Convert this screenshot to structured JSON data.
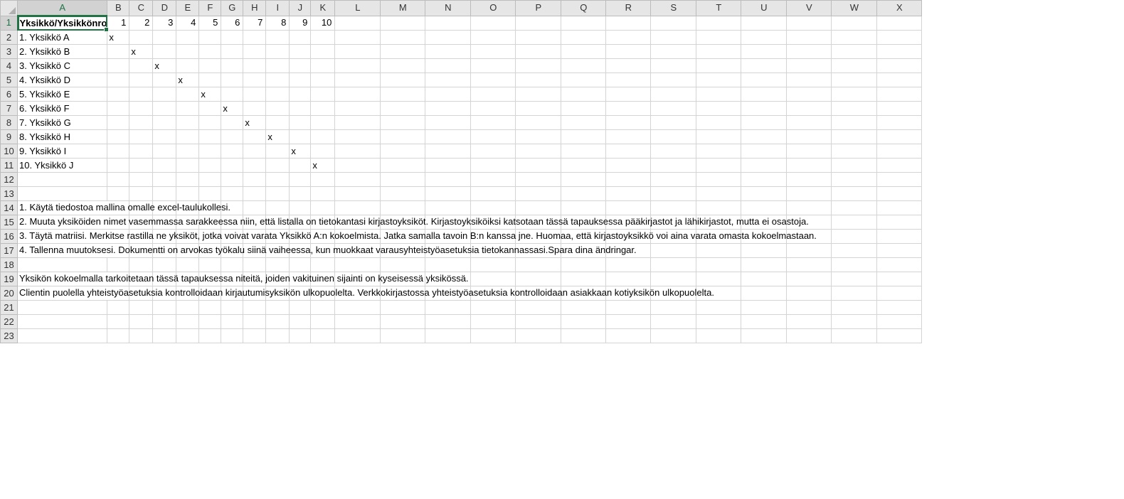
{
  "columns": [
    "A",
    "B",
    "C",
    "D",
    "E",
    "F",
    "G",
    "H",
    "I",
    "J",
    "K",
    "L",
    "M",
    "N",
    "O",
    "P",
    "Q",
    "R",
    "S",
    "T",
    "U",
    "V",
    "W",
    "X"
  ],
  "active_cell": "A1",
  "header": {
    "A1": "Yksikkö/Yksikkönro",
    "numbers": [
      "1",
      "2",
      "3",
      "4",
      "5",
      "6",
      "7",
      "8",
      "9",
      "10"
    ]
  },
  "units": [
    {
      "name": "1. Yksikkö  A",
      "mark_col": 1
    },
    {
      "name": "2. Yksikkö B",
      "mark_col": 2
    },
    {
      "name": "3. Yksikkö C",
      "mark_col": 3
    },
    {
      "name": "4. Yksikkö D",
      "mark_col": 4
    },
    {
      "name": "5. Yksikkö E",
      "mark_col": 5
    },
    {
      "name": "6. Yksikkö F",
      "mark_col": 6
    },
    {
      "name": "7. Yksikkö G",
      "mark_col": 7
    },
    {
      "name": "8. Yksikkö H",
      "mark_col": 8
    },
    {
      "name": "9. Yksikkö I",
      "mark_col": 9
    },
    {
      "name": "10. Yksikkö J",
      "mark_col": 10
    }
  ],
  "mark": "x",
  "instructions": {
    "r14": "1. Käytä tiedostoa mallina omalle excel-taulukollesi.",
    "r15": "2. Muuta yksiköiden nimet vasemmassa sarakkeessa niin, että listalla on tietokantasi kirjastoyksiköt. Kirjastoyksiköiksi katsotaan tässä tapauksessa pääkirjastot ja lähikirjastot, mutta ei osastoja.",
    "r16": "3.  Täytä matriisi. Merkitse rastilla ne yksiköt, jotka voivat varata Yksikkö A:n kokoelmista. Jatka samalla tavoin B:n kanssa jne. Huomaa, että kirjastoyksikkö voi aina varata omasta kokoelmastaan.",
    "r17": "4. Tallenna muutoksesi. Dokumentti on arvokas työkalu siinä vaiheessa, kun muokkaat varausyhteistyöasetuksia tietokannassasi.Spara dina ändringar.",
    "r19": "Yksikön kokoelmalla tarkoitetaan tässä tapauksessa niteitä, joiden vakituinen sijainti on kyseisessä yksikössä.",
    "r20": "Clientin puolella yhteistyöasetuksia kontrolloidaan kirjautumisyksikön ulkopuolelta. Verkkokirjastossa yhteistyöasetuksia kontrolloidaan asiakkaan kotiyksikön ulkopuolelta."
  },
  "row_numbers": [
    "1",
    "2",
    "3",
    "4",
    "5",
    "6",
    "7",
    "8",
    "9",
    "10",
    "11",
    "12",
    "13",
    "14",
    "15",
    "16",
    "17",
    "18",
    "19",
    "20",
    "21",
    "22",
    "23"
  ]
}
